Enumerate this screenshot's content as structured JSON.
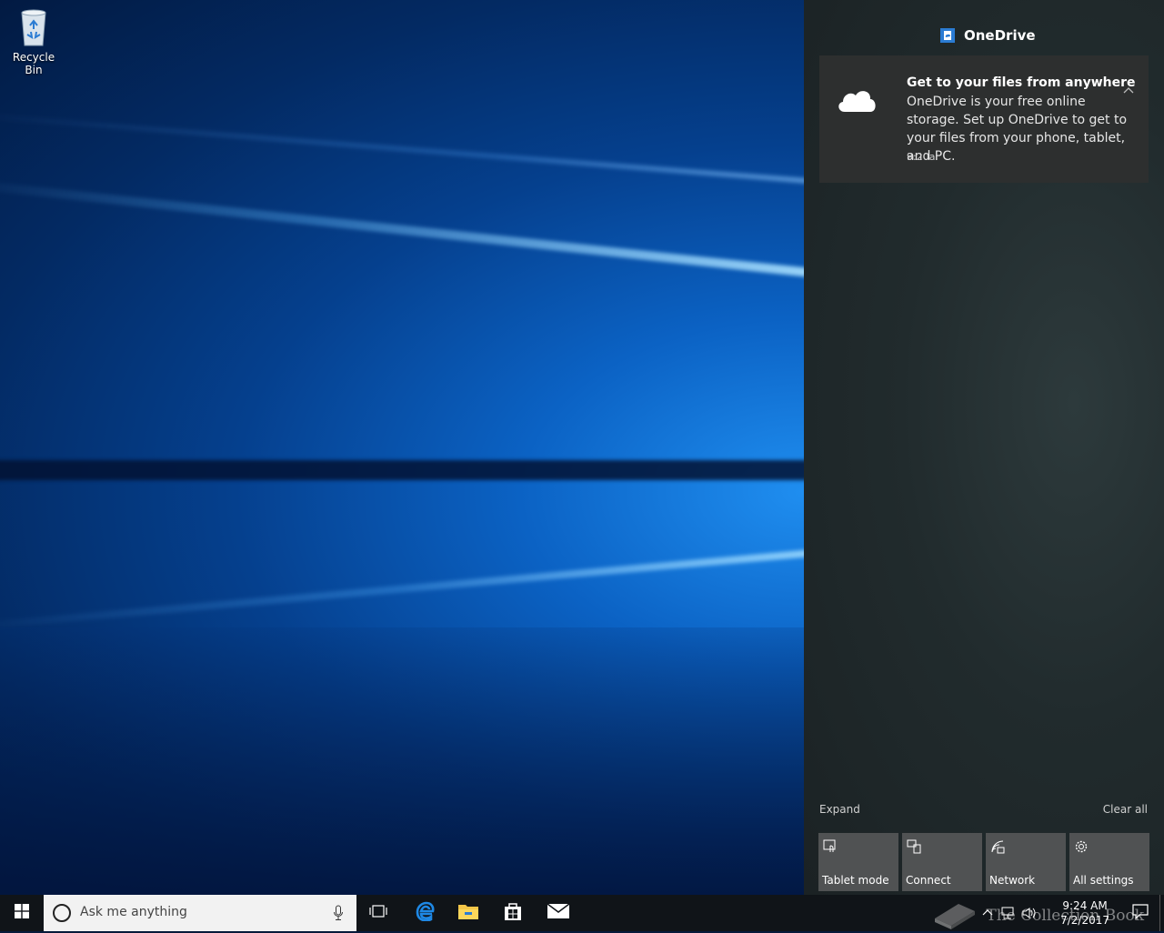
{
  "desktop": {
    "icons": [
      {
        "label": "Recycle Bin",
        "icon": "recycle-bin-icon"
      }
    ]
  },
  "action_center": {
    "header": {
      "app_name": "OneDrive",
      "icon": "onedrive-app-icon"
    },
    "notification": {
      "icon": "cloud-icon",
      "title": "Get to your files from anywhere",
      "body": "OneDrive is your free online storage. Set up OneDrive to get to your files from your phone, tablet, and PC.",
      "time": "9:20a"
    },
    "expand_label": "Expand",
    "clear_all_label": "Clear all",
    "quick_actions": [
      {
        "label": "Tablet mode",
        "icon": "tablet-mode-icon"
      },
      {
        "label": "Connect",
        "icon": "connect-icon"
      },
      {
        "label": "Network",
        "icon": "network-icon"
      },
      {
        "label": "All settings",
        "icon": "gear-icon"
      }
    ]
  },
  "taskbar": {
    "search_placeholder": "Ask me anything",
    "pinned_apps": [
      "task-view-icon",
      "edge-icon",
      "file-explorer-icon",
      "store-icon",
      "mail-icon"
    ],
    "clock": {
      "time": "9:24 AM",
      "date": "7/2/2017"
    },
    "watermark": "The Collection Book"
  },
  "colors": {
    "accent": "#2b7cd3",
    "action_center_bg": "#212b2d",
    "tile_bg": "#505253",
    "notification_bg": "#2d2f2f",
    "taskbar_bg": "#101418"
  }
}
